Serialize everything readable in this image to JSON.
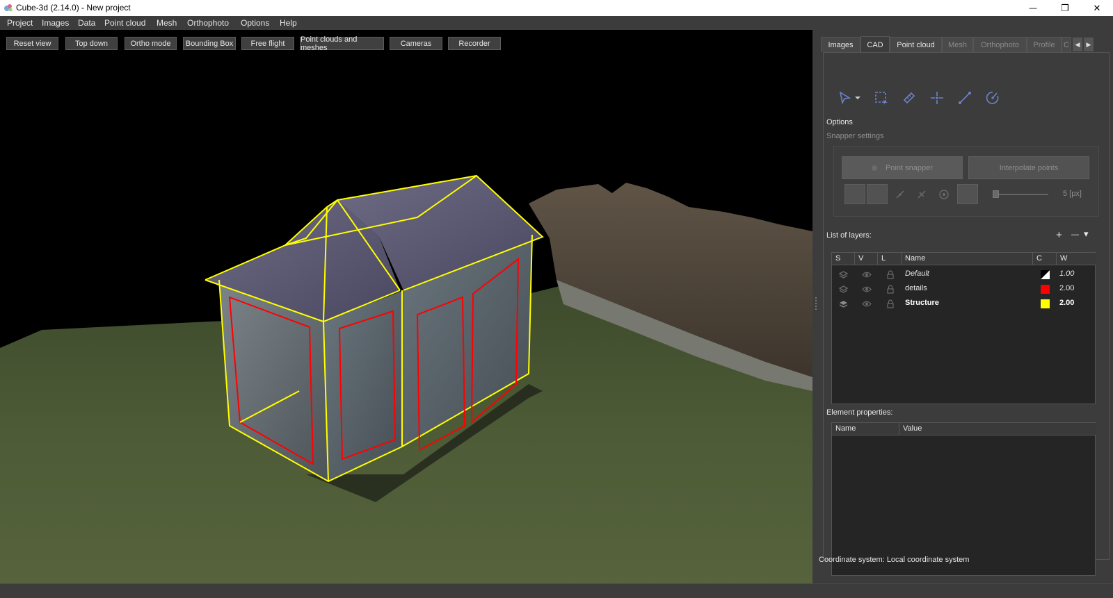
{
  "window": {
    "title": "Cube-3d (2.14.0) - New project",
    "minimize": "—",
    "maximize": "❐",
    "close": "✕"
  },
  "menu": [
    "Project",
    "Images",
    "Data",
    "Point cloud",
    "Mesh",
    "Orthophoto",
    "Options",
    "Help"
  ],
  "view_buttons": [
    "Reset view",
    "Top down",
    "Ortho mode",
    "Bounding Box",
    "Free flight",
    "Point clouds and meshes",
    "Cameras",
    "Recorder"
  ],
  "tabs": [
    {
      "label": "Images",
      "state": "normal"
    },
    {
      "label": "CAD",
      "state": "active"
    },
    {
      "label": "Point cloud",
      "state": "normal"
    },
    {
      "label": "Mesh",
      "state": "disabled"
    },
    {
      "label": "Orthophoto",
      "state": "disabled"
    },
    {
      "label": "Profile",
      "state": "disabled"
    },
    {
      "label": "C",
      "state": "disabled"
    }
  ],
  "cad": {
    "tools": [
      "select-arrow-icon",
      "rectangle-select-icon",
      "ruler-icon",
      "point-crosshair-icon",
      "line-segment-icon",
      "arc-icon"
    ],
    "options_label": "Options",
    "snapper_label": "Snapper settings",
    "point_snapper": "Point snapper",
    "interpolate_points": "Interpolate points",
    "slider_value": "5 [px]",
    "layers_label": "List of layers:",
    "add_layer": "+",
    "remove_layer": "—",
    "layers_menu": "▾",
    "layer_headers": [
      "S",
      "V",
      "L",
      "Name",
      "C",
      "W"
    ],
    "layers": [
      {
        "name": "Default",
        "color": "#ffffff",
        "width": "1.00",
        "style": "italic"
      },
      {
        "name": "details",
        "color": "#ff0000",
        "width": "2.00",
        "style": "normal"
      },
      {
        "name": "Structure",
        "color": "#ffff00",
        "width": "2.00",
        "style": "bold"
      }
    ],
    "props_label": "Element properties:",
    "props_headers": [
      "Name",
      "Value"
    ],
    "coordinate_system": "Coordinate system: Local coordinate system"
  }
}
